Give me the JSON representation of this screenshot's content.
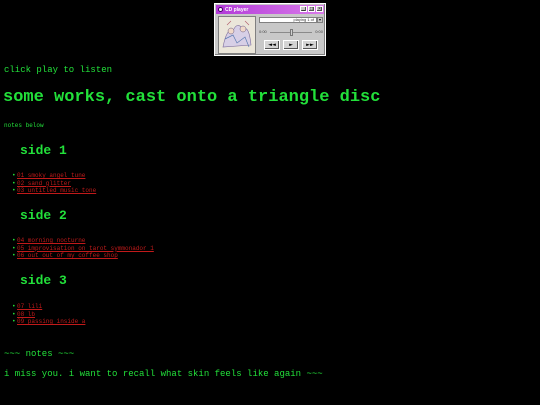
{
  "player": {
    "title": "CD player",
    "now_playing": "playing 1 of",
    "time_start": "0:00",
    "time_end": "0:00",
    "seek_fraction": 0.5,
    "buttons": {
      "prev": "◄◄",
      "play": "►",
      "next": "►►"
    }
  },
  "intro": "click play to listen",
  "heading": "some works, cast onto a triangle disc",
  "notes_below": "notes below",
  "sides": [
    {
      "title": "side 1",
      "tracks": [
        "01 smoky angel tune",
        "02 sand glitter",
        "03 untitled music tone"
      ]
    },
    {
      "title": "side 2",
      "tracks": [
        "04 morning nocturne",
        "05 improvisation on tarot symmonador 1",
        "06 out out of my coffee shop"
      ]
    },
    {
      "title": "side 3",
      "tracks": [
        "07 lili",
        "08 lb",
        "09 passing inside a"
      ]
    }
  ],
  "notes_header": "~~~ notes ~~~",
  "note": "i miss you. i want to recall what skin feels like again ~~~"
}
